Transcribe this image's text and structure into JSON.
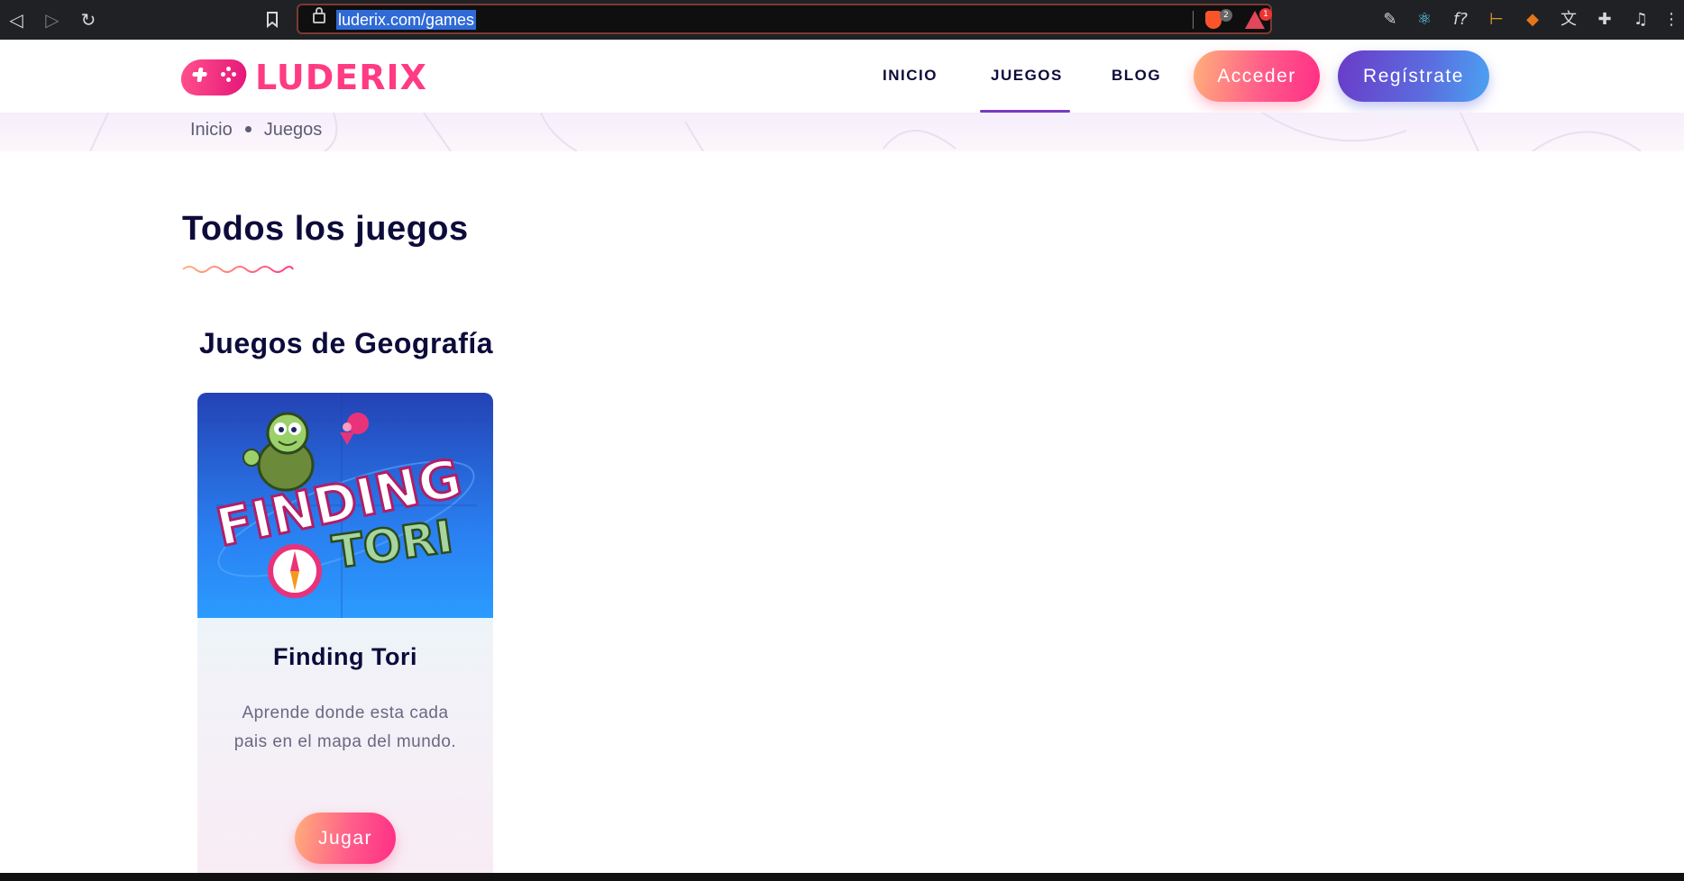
{
  "browser": {
    "url": "luderix.com/games",
    "shield_count": "2",
    "rewards_count": "1"
  },
  "site": {
    "logo_text": "LUDERIX",
    "nav": [
      {
        "label": "INICIO"
      },
      {
        "label": "JUEGOS"
      },
      {
        "label": "BLOG"
      }
    ],
    "login_label": "Acceder",
    "register_label": "Regístrate"
  },
  "breadcrumb": {
    "home": "Inicio",
    "current": "Juegos"
  },
  "main": {
    "title": "Todos los juegos",
    "sections": [
      {
        "title": "Juegos de Geografía",
        "games": [
          {
            "logo_text_1": "FINDING",
            "logo_text_2": "TORI",
            "name": "Finding Tori",
            "description": "Aprende donde esta cada pais en el mapa del mundo.",
            "play_label": "Jugar"
          }
        ]
      }
    ]
  },
  "colors": {
    "accent_pink": "#ff3b83",
    "accent_purple": "#7a39c2",
    "heading": "#0d0b3b"
  }
}
